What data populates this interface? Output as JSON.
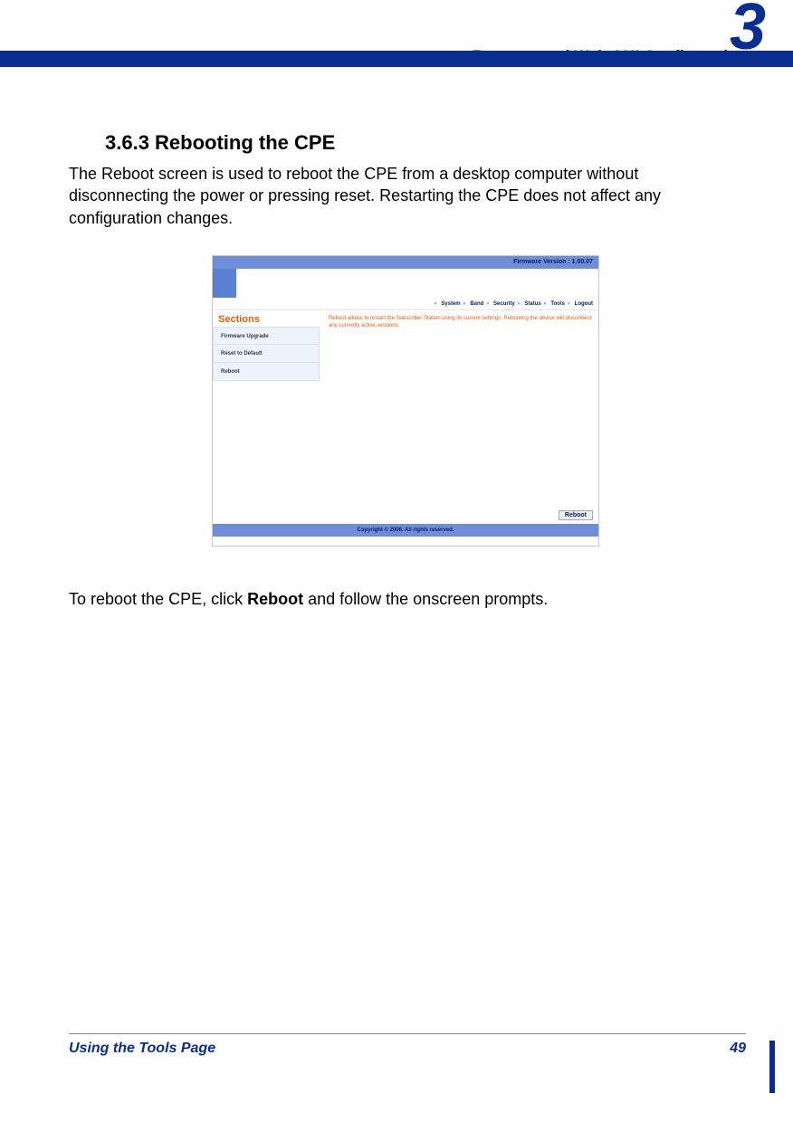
{
  "chapter": {
    "number": "3",
    "header": "Features and Web GUI Configuration"
  },
  "section": {
    "heading": "3.6.3 Rebooting the CPE",
    "para1": "The Reboot screen is used to reboot the CPE from a desktop computer without disconnecting the power or pressing reset. Restarting the CPE does not affect any configuration changes.",
    "para2_a": "To reboot the CPE, click ",
    "para2_b": "Reboot",
    "para2_c": " and follow the onscreen prompts."
  },
  "ui": {
    "firmware_label": "Firmware Version : 1.00.07",
    "nav": [
      "System",
      "Band",
      "Security",
      "Status",
      "Tools",
      "Logout"
    ],
    "nav_sep": "»",
    "sidebar_title": "Sections",
    "sidebar_items": [
      "Firmware Upgrade",
      "Reset to Default",
      "Reboot"
    ],
    "content_msg": "Reboot allows to restart the Subscriber Station using its current settings. Rebooting the device will disconnect any currently active sessions.",
    "reboot_button": "Reboot",
    "copyright": "Copyright © 2008.  All rights reserved."
  },
  "footer": {
    "title": "Using the Tools Page",
    "page": "49"
  }
}
